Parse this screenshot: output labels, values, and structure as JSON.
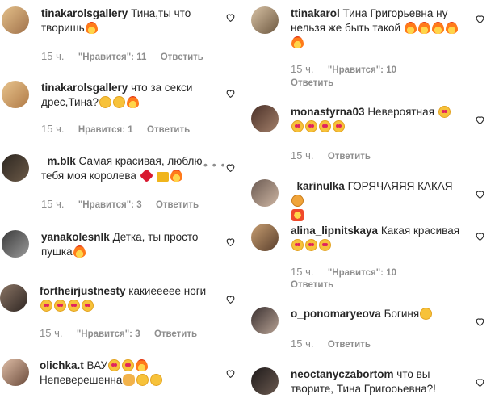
{
  "left": [
    {
      "user": "tinakarolsgallery",
      "text": "Тина,ты что творишь",
      "emojis_after": [
        "fire"
      ],
      "time": "15 ч.",
      "likes": "\"Нравится\": 11",
      "reply": "Ответить"
    },
    {
      "user": "tinakarolsgallery",
      "text": "что за секси дрес,Тина?",
      "emojis_after": [
        "laugh",
        "smile",
        "fire"
      ],
      "time": "15 ч.",
      "likes": "Нравится: 1",
      "reply": "Ответить"
    },
    {
      "user": "_m.blk",
      "text": "Самая красивая, люблю тебя моя королева",
      "emojis_after": [
        "heart",
        "crown",
        "fire"
      ],
      "time": "15 ч.",
      "likes": "\"Нравится\": 3",
      "reply": "Ответить",
      "more": "• • •"
    },
    {
      "user": "yanakolesnlk",
      "text": "Детка, ты просто пушка",
      "emojis_after": [
        "fire"
      ],
      "time": "",
      "likes": "",
      "reply": ""
    },
    {
      "user": "fortheirjustnesty",
      "text": "какиеееее ноги",
      "emojis_after": [
        "heart-eyes",
        "heart-eyes",
        "heart-eyes",
        "heart-eyes"
      ],
      "time": "15 ч.",
      "likes": "\"Нравится\": 3",
      "reply": "Ответить"
    },
    {
      "user": "olichka.t",
      "text": "ВАУ",
      "emojis_after": [
        "heart-eyes",
        "heart-eyes",
        "fire"
      ],
      "text2": "Непеверешенна",
      "emojis_after2": [
        "clap",
        "blush",
        "wink"
      ],
      "time": "",
      "likes": "",
      "reply": ""
    }
  ],
  "right": [
    {
      "user": "ttinakarol",
      "text": "Тина Григорьевна ну нельзя же быть такой",
      "emojis_after": [
        "fire",
        "fire",
        "fire",
        "fire",
        "fire"
      ],
      "time": "15 ч.",
      "likes": "\"Нравится\": 10",
      "reply": "Ответить"
    },
    {
      "user": "monastyrna03",
      "text": "Невероятная",
      "emojis_after": [
        "heart-eyes",
        "heart-eyes",
        "heart-eyes",
        "heart-eyes",
        "heart-eyes"
      ],
      "time": "15 ч.",
      "likes": "",
      "reply": "Ответить"
    },
    {
      "user": "_karinulka",
      "text": "ГОРЯЧАЯЯЯ КАКАЯ",
      "emojis_after": [
        "cat",
        "boom"
      ],
      "time": "",
      "likes": "",
      "reply": ""
    },
    {
      "user": "alina_lipnitskaya",
      "text": "Какая красивая",
      "emojis_after": [
        "heart-eyes",
        "heart-eyes",
        "heart-eyes"
      ],
      "time": "15 ч.",
      "likes": "\"Нравится\": 10",
      "reply": "Ответить"
    },
    {
      "user": "o_ponomaryeova",
      "text": "Богиня",
      "emojis_after": [
        "wink"
      ],
      "time": "15 ч.",
      "likes": "",
      "reply": "Ответить"
    },
    {
      "user": "neoctanyczabortom",
      "text": "что вы творите, Тина Григооьевна?!",
      "emojis_after": [],
      "time": "",
      "likes": "",
      "reply": ""
    }
  ],
  "avatar_colors": [
    "#c9a27d",
    "#b88a5d",
    "#3b342f",
    "#8a8a8a",
    "#6d5a4d",
    "#4a3c36",
    "#d4b5a0",
    "#5a3d33",
    "#6b5c55",
    "#b39880",
    "#7b6a66",
    "#3d3434"
  ]
}
